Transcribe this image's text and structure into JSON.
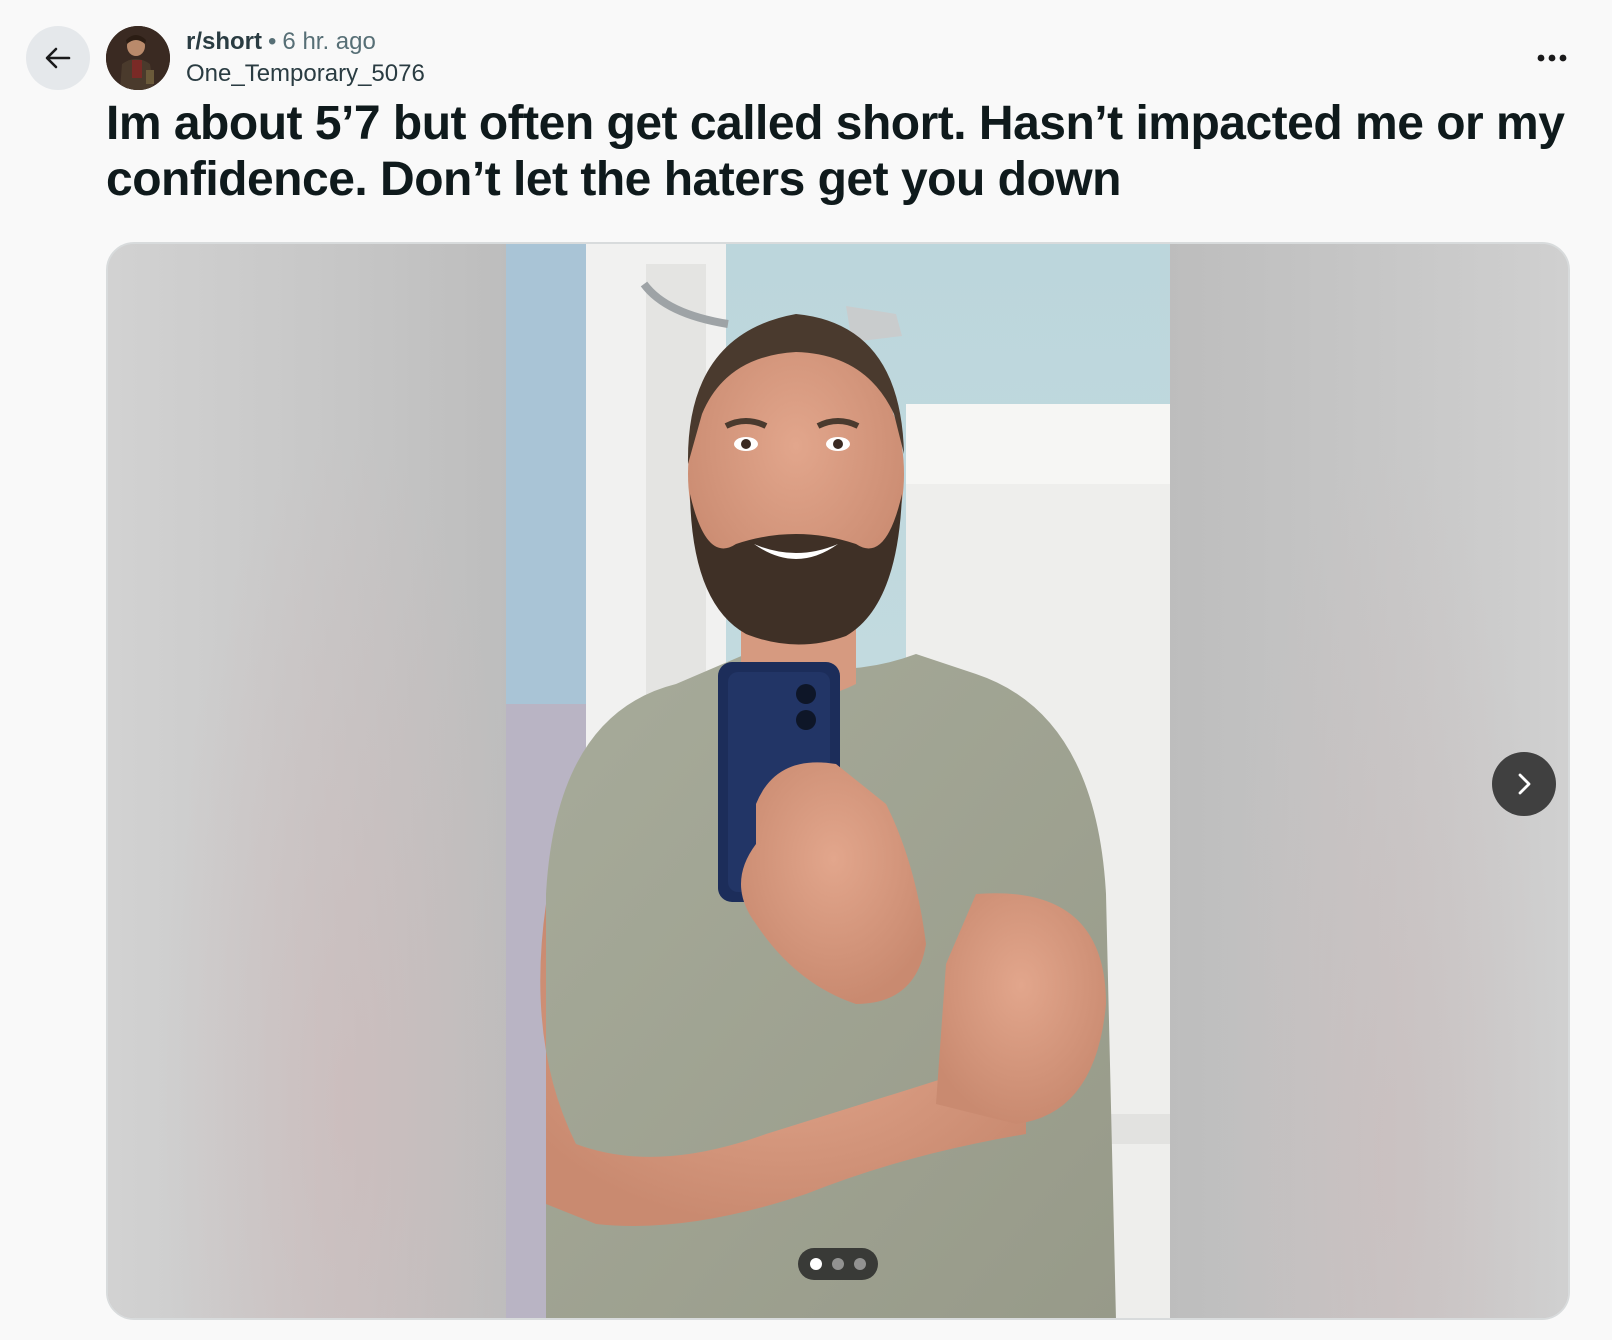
{
  "post": {
    "subreddit": "r/short",
    "separator": "•",
    "time_ago": "6 hr. ago",
    "username": "One_Temporary_5076",
    "title": "Im about 5’7 but often get called short. Hasn’t impacted me or my confidence. Don’t let the haters get you down"
  },
  "nav": {
    "back_icon": "arrow-left-icon",
    "more_icon": "more-horizontal-icon"
  },
  "gallery": {
    "total_images": 3,
    "current_index": 1,
    "next_icon": "chevron-right-icon"
  },
  "colors": {
    "background": "#f9f9f9",
    "title_text": "#0f1a1c",
    "meta_text": "#576f76",
    "back_button_bg": "#e5e8eb"
  }
}
